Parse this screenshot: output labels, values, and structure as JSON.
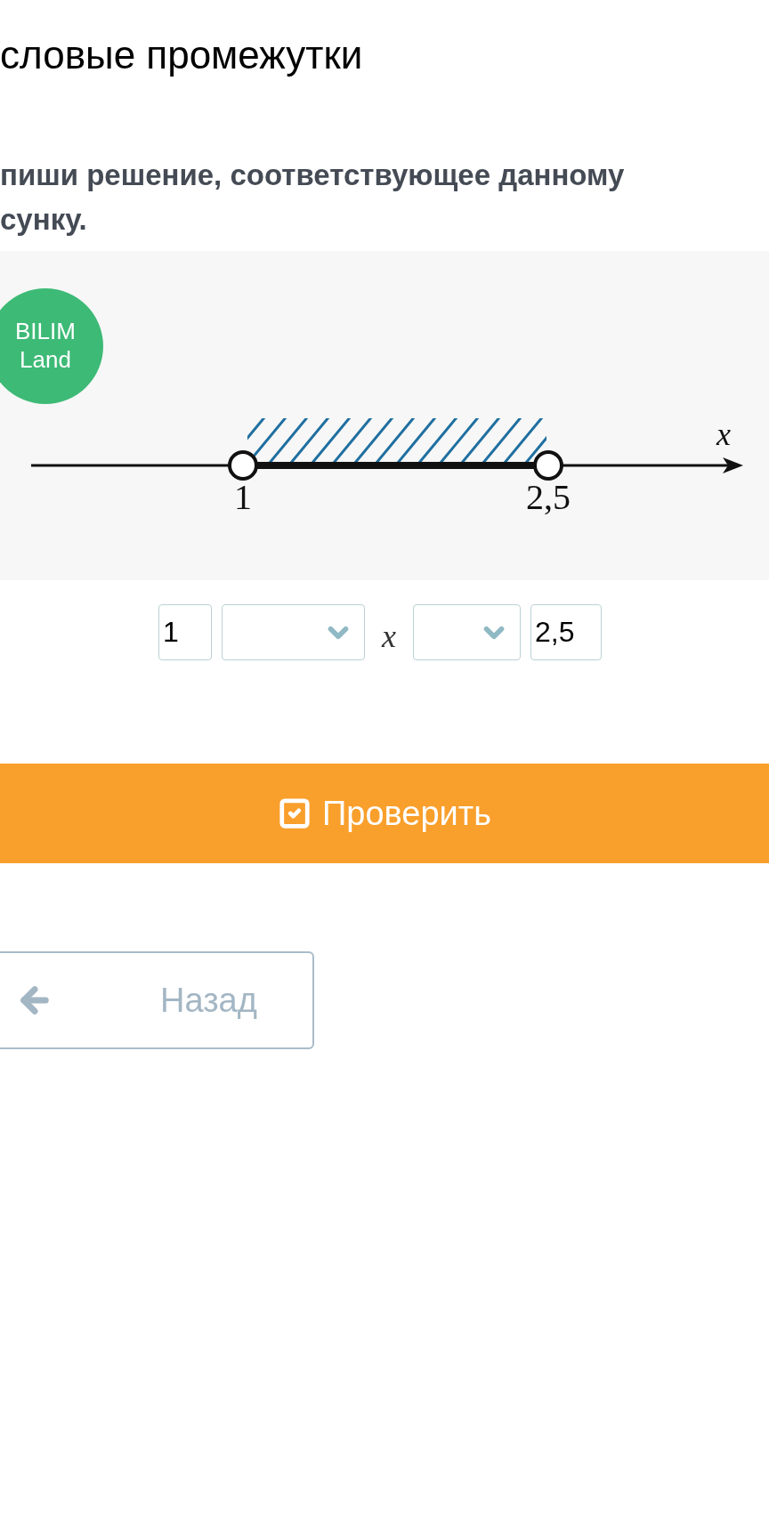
{
  "page_title": "словые промежутки",
  "instruction": [
    "пиши решение, соответствующее данному",
    "сунку."
  ],
  "figure": {
    "logo": [
      "BILIM",
      "Land"
    ],
    "axis_label": "x",
    "points": [
      {
        "label": "1",
        "open": true
      },
      {
        "label": "2,5",
        "open": true
      }
    ]
  },
  "answer": [
    {
      "kind": "field",
      "value": "1"
    },
    {
      "kind": "select"
    },
    {
      "kind": "variable",
      "text": "x"
    },
    {
      "kind": "select"
    },
    {
      "kind": "field",
      "value": "2,5"
    }
  ],
  "check_button": "Проверить",
  "back_button": "Назад"
}
